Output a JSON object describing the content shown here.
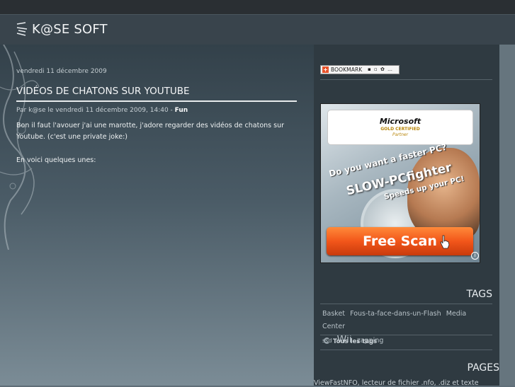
{
  "header": {
    "brand_title": "K@SE SOFT"
  },
  "post": {
    "date": "vendredi 11 décembre 2009",
    "title": "VIDÉOS DE CHATONS SUR YOUTUBE",
    "meta_prefix": "Par k@se le vendredi 11 décembre 2009, 14:40 - ",
    "category": "Fun",
    "paragraphs": [
      "Bon il faut l'avouer j'ai une marotte, j'adore regarder des vidéos de chatons sur Youtube. (c'est une private joke:)",
      "En voici quelques unes:"
    ]
  },
  "sidebar": {
    "bookmark": {
      "label": "BOOKMARK",
      "icons": "▪ ▫ ✿ …"
    },
    "ad": {
      "ms_brand": "Microsoft",
      "ms_certified": "GOLD CERTIFIED",
      "ms_partner": "Partner",
      "headline": "Do you want a faster PC?",
      "product": "SLOW-PCfighter",
      "tagline": "Speeds up your PC!",
      "button": "Free Scan",
      "info": "i"
    },
    "tags": {
      "title": "TAGS",
      "items": [
        "Basket",
        "Fous-ta-face-dans-un-Flash",
        "Media Center",
        "ssd",
        "Wii",
        "zapping"
      ],
      "all_tags": "Tous les tags"
    },
    "pages": {
      "title": "PAGES",
      "first_link": "ViewFastNFO, lecteur de fichier .nfo, .diz et texte"
    }
  },
  "colors": {
    "header_bg": "#39444c",
    "sidebar_bg": "#2f3a41",
    "ad_button": "#f2561a"
  }
}
